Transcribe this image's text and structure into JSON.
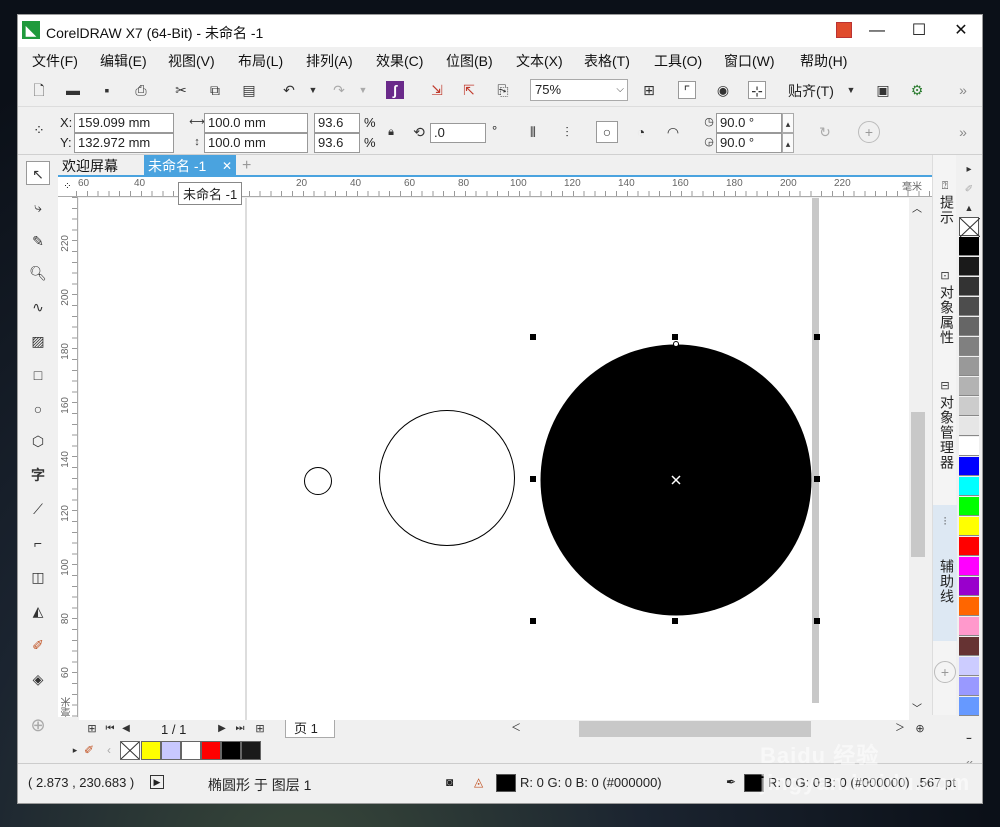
{
  "window": {
    "title": "CorelDRAW X7 (64-Bit) - 未命名 -1",
    "minimize": "—",
    "maximize": "☐",
    "close": "✕"
  },
  "menu": {
    "items": [
      "文件(F)",
      "编辑(E)",
      "视图(V)",
      "布局(L)",
      "排列(A)",
      "效果(C)",
      "位图(B)",
      "文本(X)",
      "表格(T)",
      "工具(O)",
      "窗口(W)",
      "帮助(H)"
    ]
  },
  "toolbar": {
    "zoom_value": "75%",
    "snap_label": "贴齐(T)",
    "overflow": "»"
  },
  "property_bar": {
    "x_label": "X:",
    "x_value": "159.099 mm",
    "y_label": "Y:",
    "y_value": "132.972 mm",
    "width_value": "100.0 mm",
    "height_value": "100.0 mm",
    "scale_x": "93.6",
    "scale_y": "93.6",
    "percent": "%",
    "rotation": ".0",
    "degree": "°",
    "start_angle": "90.0 °",
    "end_angle": "90.0 °"
  },
  "doc_tabs": {
    "welcome": "欢迎屏幕",
    "active": "未命名 -1",
    "tooltip": "未命名 -1",
    "add": "+",
    "close": "✕"
  },
  "rulers": {
    "unit": "毫米",
    "h_ticks": [
      "60",
      "40",
      "20",
      "40",
      "60",
      "80",
      "100",
      "120",
      "140",
      "160",
      "180",
      "200",
      "220"
    ],
    "v_ticks": [
      "220",
      "200",
      "180",
      "160",
      "140",
      "120",
      "100",
      "80",
      "60"
    ]
  },
  "page_nav": {
    "page_count": "1 / 1",
    "page_tab": "页 1"
  },
  "docker": {
    "hints": "提示",
    "object_properties": "对象属性",
    "object_manager": "对象管理器",
    "guides": "辅助线"
  },
  "palette": {
    "colors": [
      "#000000",
      "#1a1a1a",
      "#333333",
      "#4d4d4d",
      "#666666",
      "#808080",
      "#999999",
      "#b3b3b3",
      "#cccccc",
      "#e6e6e6",
      "#ffffff",
      "#0000ff",
      "#00ffff",
      "#00ff00",
      "#ffff00",
      "#ff0000",
      "#ff00ff",
      "#9900cc",
      "#ff6600",
      "#ff99cc",
      "#663333",
      "#ccccff",
      "#9999ff",
      "#6699ff"
    ]
  },
  "doc_palette": {
    "colors": [
      "#ffff00",
      "#c8c8ff",
      "#ffffff",
      "#ff0000",
      "#000000",
      "#1a1a1a"
    ]
  },
  "status": {
    "coords": "( 2.873 , 230.683 )",
    "object_info": "椭圆形 于 图层 1",
    "fill_info": "R: 0 G: 0 B: 0 (#000000)",
    "outline_info": "R: 0 G: 0 B: 0 (#000000)",
    "outline_width": ".567 pt",
    "fill_color": "#000000",
    "outline_color": "#000000"
  },
  "watermark": "Baidu 经验 jingyan.baidu.com"
}
